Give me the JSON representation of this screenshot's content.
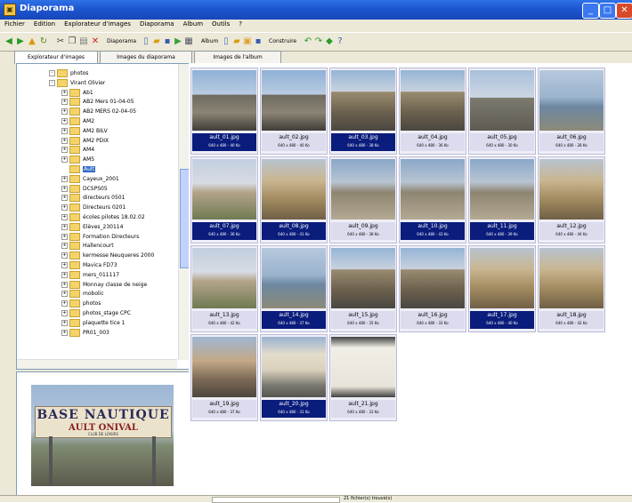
{
  "window": {
    "title": "Diaporama"
  },
  "menu": [
    "Fichier",
    "Edition",
    "Explorateur d'images",
    "Diaporama",
    "Album",
    "Outils",
    "?"
  ],
  "toolbar": {
    "diaporama_label": "Diaporama",
    "album_label": "Album",
    "construire_label": "Construire"
  },
  "tabs": [
    "Explorateur d'images",
    "Images du diaporama",
    "Images de l'album"
  ],
  "tree": [
    {
      "label": "photos",
      "level": 1,
      "expander": "-"
    },
    {
      "label": "Virant Olivier",
      "level": 1,
      "expander": "-"
    },
    {
      "label": "Ab1",
      "level": 2,
      "expander": "+"
    },
    {
      "label": "AB2 Mers 01-04-05",
      "level": 2,
      "expander": "+"
    },
    {
      "label": "AB2 MERS 02-04-05",
      "level": 2,
      "expander": "+"
    },
    {
      "label": "AM2",
      "level": 2,
      "expander": "+"
    },
    {
      "label": "AM2 BILV",
      "level": 2,
      "expander": "+"
    },
    {
      "label": "AM2 PDIX",
      "level": 2,
      "expander": "+"
    },
    {
      "label": "AM4",
      "level": 2,
      "expander": "+"
    },
    {
      "label": "AM5",
      "level": 2,
      "expander": "+"
    },
    {
      "label": "Ault",
      "level": 2,
      "expander": "",
      "selected": true
    },
    {
      "label": "Cayeux_2001",
      "level": 2,
      "expander": "+"
    },
    {
      "label": "DCSPS05",
      "level": 2,
      "expander": "+"
    },
    {
      "label": "directeurs 0501",
      "level": 2,
      "expander": "+"
    },
    {
      "label": "Directeurs 0201",
      "level": 2,
      "expander": "+"
    },
    {
      "label": "écoles pilotes 18.02.02",
      "level": 2,
      "expander": "+"
    },
    {
      "label": "Elèves_230114",
      "level": 2,
      "expander": "+"
    },
    {
      "label": "Formation Directeurs",
      "level": 2,
      "expander": "+"
    },
    {
      "label": "Hallencourt",
      "level": 2,
      "expander": "+"
    },
    {
      "label": "kermesse Neuqueres 2000",
      "level": 2,
      "expander": "+"
    },
    {
      "label": "Mavica FD73",
      "level": 2,
      "expander": "+"
    },
    {
      "label": "mers_011117",
      "level": 2,
      "expander": "+"
    },
    {
      "label": "Monnay classe de neige",
      "level": 2,
      "expander": "+"
    },
    {
      "label": "mobolic",
      "level": 2,
      "expander": "+"
    },
    {
      "label": "photos",
      "level": 2,
      "expander": "+"
    },
    {
      "label": "photos_stage CPC",
      "level": 2,
      "expander": "+"
    },
    {
      "label": "plaquette tice 1",
      "level": 2,
      "expander": "+"
    },
    {
      "label": "PR01_003",
      "level": 2,
      "expander": "+"
    }
  ],
  "preview": {
    "sign_line1": "BASE NAUTIQUE",
    "sign_line2": "AULT  ONIVAL",
    "sign_line3": "CLUB DE LOISIRS"
  },
  "thumbnails": [
    {
      "file": "ault_01.jpg",
      "dims": "640 x 480 - 40 Ko",
      "selected": true,
      "scene": "house"
    },
    {
      "file": "ault_02.jpg",
      "dims": "640 x 480 - 40 Ko",
      "selected": false,
      "scene": "house"
    },
    {
      "file": "ault_03.jpg",
      "dims": "640 x 480 - 38 Ko",
      "selected": true,
      "scene": "street"
    },
    {
      "file": "ault_04.jpg",
      "dims": "640 x 480 - 36 Ko",
      "selected": false,
      "scene": "street"
    },
    {
      "file": "ault_05.jpg",
      "dims": "640 x 480 - 30 Ko",
      "selected": false,
      "scene": "road"
    },
    {
      "file": "ault_06.jpg",
      "dims": "640 x 480 - 28 Ko",
      "selected": false,
      "scene": "sea"
    },
    {
      "file": "ault_07.jpg",
      "dims": "640 x 480 - 36 Ko",
      "selected": true,
      "scene": "cliff"
    },
    {
      "file": "ault_08.jpg",
      "dims": "640 x 480 - 41 Ko",
      "selected": true,
      "scene": "rock"
    },
    {
      "file": "ault_09.jpg",
      "dims": "640 x 480 - 38 Ko",
      "selected": false,
      "scene": "beach"
    },
    {
      "file": "ault_10.jpg",
      "dims": "640 x 480 - 43 Ko",
      "selected": true,
      "scene": "beach"
    },
    {
      "file": "ault_11.jpg",
      "dims": "640 x 480 - 39 Ko",
      "selected": true,
      "scene": "beach"
    },
    {
      "file": "ault_12.jpg",
      "dims": "640 x 480 - 44 Ko",
      "selected": false,
      "scene": "rock"
    },
    {
      "file": "ault_13.jpg",
      "dims": "640 x 480 - 42 Ko",
      "selected": false,
      "scene": "cliff"
    },
    {
      "file": "ault_14.jpg",
      "dims": "640 x 480 - 37 Ko",
      "selected": true,
      "scene": "sea"
    },
    {
      "file": "ault_15.jpg",
      "dims": "640 x 480 - 35 Ko",
      "selected": false,
      "scene": "street"
    },
    {
      "file": "ault_16.jpg",
      "dims": "640 x 480 - 33 Ko",
      "selected": false,
      "scene": "street"
    },
    {
      "file": "ault_17.jpg",
      "dims": "640 x 480 - 40 Ko",
      "selected": true,
      "scene": "rock"
    },
    {
      "file": "ault_18.jpg",
      "dims": "640 x 480 - 42 Ko",
      "selected": false,
      "scene": "rock"
    },
    {
      "file": "ault_19.jpg",
      "dims": "640 x 480 - 37 Ko",
      "selected": false,
      "scene": "town"
    },
    {
      "file": "ault_20.jpg",
      "dims": "640 x 480 - 31 Ko",
      "selected": true,
      "scene": "sign"
    },
    {
      "file": "ault_21.jpg",
      "dims": "640 x 480 - 33 Ko",
      "selected": false,
      "scene": "board"
    }
  ],
  "status": {
    "count_text": "21 fichier(s) trouvé(s)"
  },
  "colors": {
    "title_bar": "#1d55d1",
    "selection": "#0a1c7c",
    "caption_bg": "#dcdcee"
  }
}
